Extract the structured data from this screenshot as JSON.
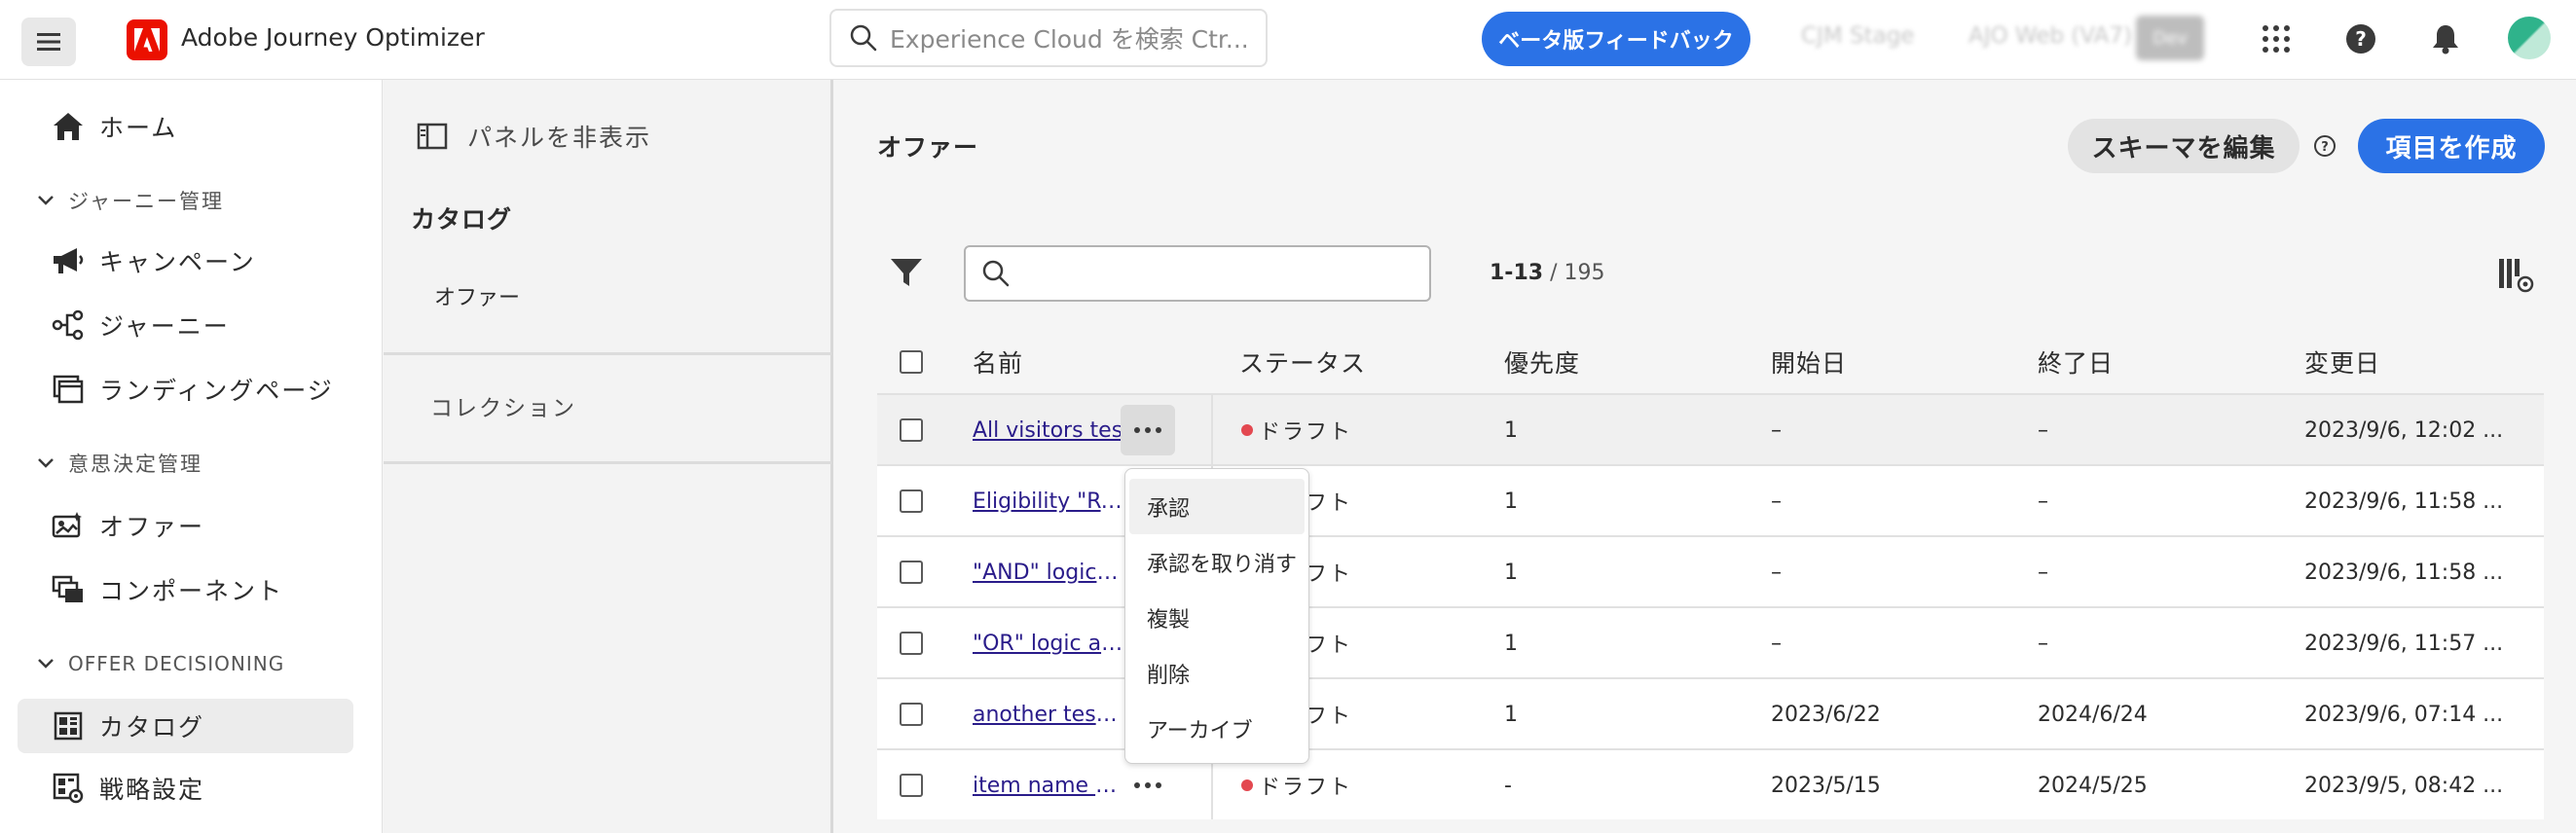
{
  "app": {
    "name": "Adobe Journey Optimizer",
    "search_placeholder": "Experience Cloud を検索 Ctr...",
    "beta_feedback": "ベータ版フィードバック",
    "sandbox": "CJM Stage",
    "org": "AJO Web (VA7)",
    "env_badge": "Dev"
  },
  "nav": {
    "home": "ホーム",
    "journey_mgmt": "ジャーニー管理",
    "campaigns": "キャンペーン",
    "journeys": "ジャーニー",
    "landing_pages": "ランディングページ",
    "decision_mgmt": "意思決定管理",
    "offers": "オファー",
    "components": "コンポーネント",
    "offer_decisioning": "OFFER DECISIONING",
    "catalog": "カタログ",
    "strategy": "戦略設定"
  },
  "panel": {
    "hide": "パネルを非表示",
    "catalog": "カタログ",
    "offers": "オファー",
    "collections": "コレクション"
  },
  "main": {
    "title": "オファー",
    "edit_schema": "スキーマを編集",
    "create_item": "項目を作成",
    "search_value": "",
    "range": "1-13",
    "total": "/ 195"
  },
  "table": {
    "columns": [
      "名前",
      "ステータス",
      "優先度",
      "開始日",
      "終了日",
      "変更日"
    ],
    "rows": [
      {
        "name": "All visitors test",
        "status": "ドラフト",
        "priority": "1",
        "start": "–",
        "end": "–",
        "modified": "2023/9/6, 12:02 ..."
      },
      {
        "name": "Eligibility \"Ru...",
        "status": "ドラフト",
        "priority": "1",
        "start": "–",
        "end": "–",
        "modified": "2023/9/6, 11:58 ..."
      },
      {
        "name": "\"AND\" logic a...",
        "status": "ドラフト",
        "priority": "1",
        "start": "–",
        "end": "–",
        "modified": "2023/9/6, 11:58 ..."
      },
      {
        "name": "\"OR\" logic au...",
        "status": "ドラフト",
        "priority": "1",
        "start": "–",
        "end": "–",
        "modified": "2023/9/6, 11:57 ..."
      },
      {
        "name": "another test i...",
        "status": "ドラフト",
        "priority": "1",
        "start": "2023/6/22",
        "end": "2024/6/24",
        "modified": "2023/9/6, 07:14 ..."
      },
      {
        "name": "item name e...",
        "status": "ドラフト",
        "priority": "-",
        "start": "2023/5/15",
        "end": "2024/5/25",
        "modified": "2023/9/5, 08:42 ..."
      }
    ]
  },
  "context_menu": {
    "items": [
      "承認",
      "承認を取り消す",
      "複製",
      "削除",
      "アーカイブ"
    ]
  },
  "colors": {
    "accent": "#2b72e6",
    "brand": "#eb1000",
    "draft": "#e34850"
  }
}
